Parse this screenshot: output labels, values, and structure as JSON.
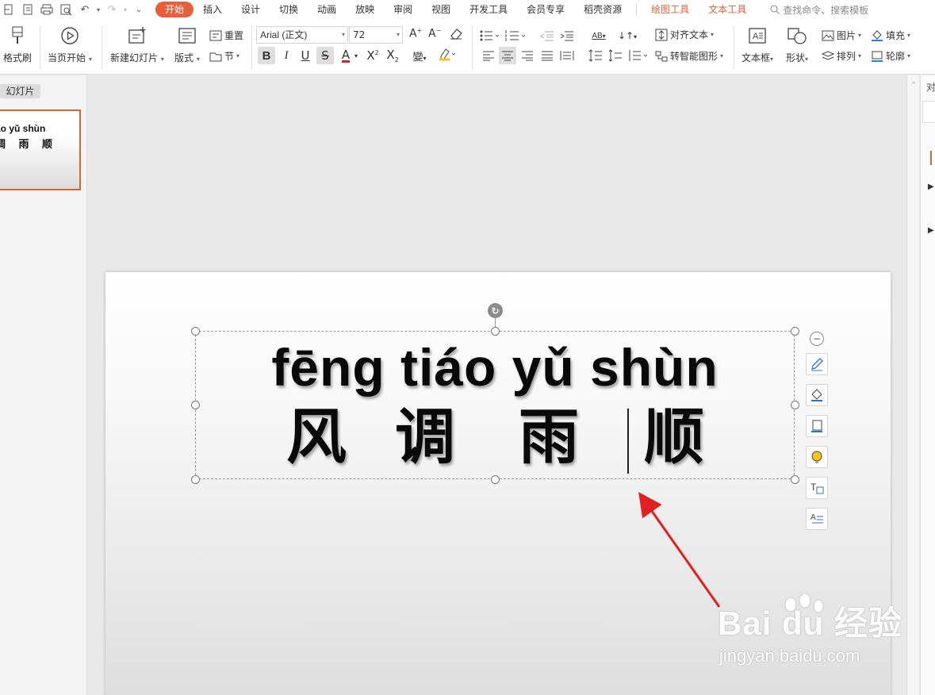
{
  "menubar": {
    "tabs": [
      {
        "label": "开始",
        "active": true
      },
      {
        "label": "插入"
      },
      {
        "label": "设计"
      },
      {
        "label": "切换"
      },
      {
        "label": "动画"
      },
      {
        "label": "放映"
      },
      {
        "label": "审阅"
      },
      {
        "label": "视图"
      },
      {
        "label": "开发工具"
      },
      {
        "label": "会员专享"
      },
      {
        "label": "稻壳资源"
      }
    ],
    "context_tabs": [
      "绘图工具",
      "文本工具"
    ],
    "search_label": "查找命令、搜索模板"
  },
  "ribbon": {
    "format_painter": "格式刷",
    "from_current": "当页开始",
    "new_slide": "新建幻灯片",
    "layout": "版式",
    "reset": "重置",
    "section": "节",
    "font_name": "Arial (正文)",
    "font_size": "72",
    "align_text": "对齐文本",
    "smart_art": "转智能图形",
    "text_box": "文本框",
    "shape": "形状",
    "picture": "图片",
    "fill": "填充",
    "arrange": "排列",
    "outline": "轮廓"
  },
  "left_panel": {
    "tab_label": "幻灯片",
    "thumb_line1": "áo yǔ shùn",
    "thumb_line2": "调 雨 顺"
  },
  "slide": {
    "pinyin": "fēng tiáo yǔ shùn",
    "chars": [
      "风",
      "调",
      "雨",
      "顺"
    ]
  },
  "right_panel": {
    "top_label": "对"
  },
  "watermark": {
    "brand": "Bai du 经验",
    "url": "jingyan.baidu.com"
  },
  "colors": {
    "accent": "#e8603b",
    "selection": "#d0683a",
    "arrow": "#e02020"
  }
}
